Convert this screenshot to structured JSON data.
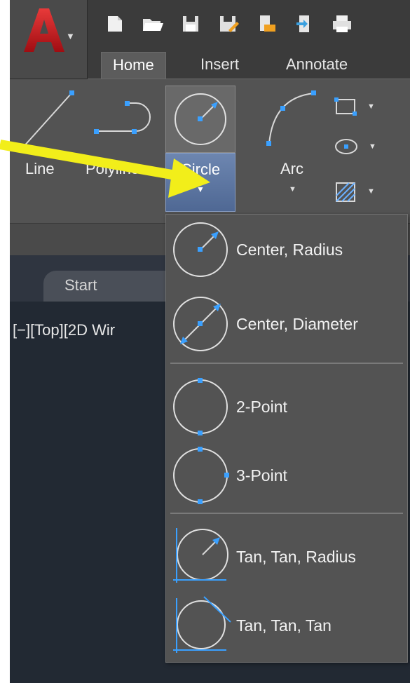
{
  "tabs": [
    {
      "label": "Home",
      "active": true
    },
    {
      "label": "Insert",
      "active": false
    },
    {
      "label": "Annotate",
      "active": false
    }
  ],
  "ribbon": {
    "line_label": "Line",
    "polyline_label": "Polyline",
    "circle_label": "Circle",
    "arc_label": "Arc"
  },
  "start_tab_label": "Start",
  "viewport_label": "[−][Top][2D Wir",
  "circle_menu": {
    "items": [
      {
        "label": "Center, Radius",
        "icon": "circle-center-radius-icon"
      },
      {
        "label": "Center, Diameter",
        "icon": "circle-center-diameter-icon"
      },
      {
        "label": "2-Point",
        "icon": "circle-2point-icon"
      },
      {
        "label": "3-Point",
        "icon": "circle-3point-icon"
      },
      {
        "label": "Tan, Tan, Radius",
        "icon": "circle-tan-tan-radius-icon"
      },
      {
        "label": "Tan, Tan, Tan",
        "icon": "circle-tan-tan-tan-icon"
      }
    ]
  },
  "colors": {
    "app_logo": "#c8151b",
    "accent_arrow": "#f2ee1a",
    "highlight_blue": "#5d78a4",
    "grip_blue": "#3aa0ff"
  }
}
